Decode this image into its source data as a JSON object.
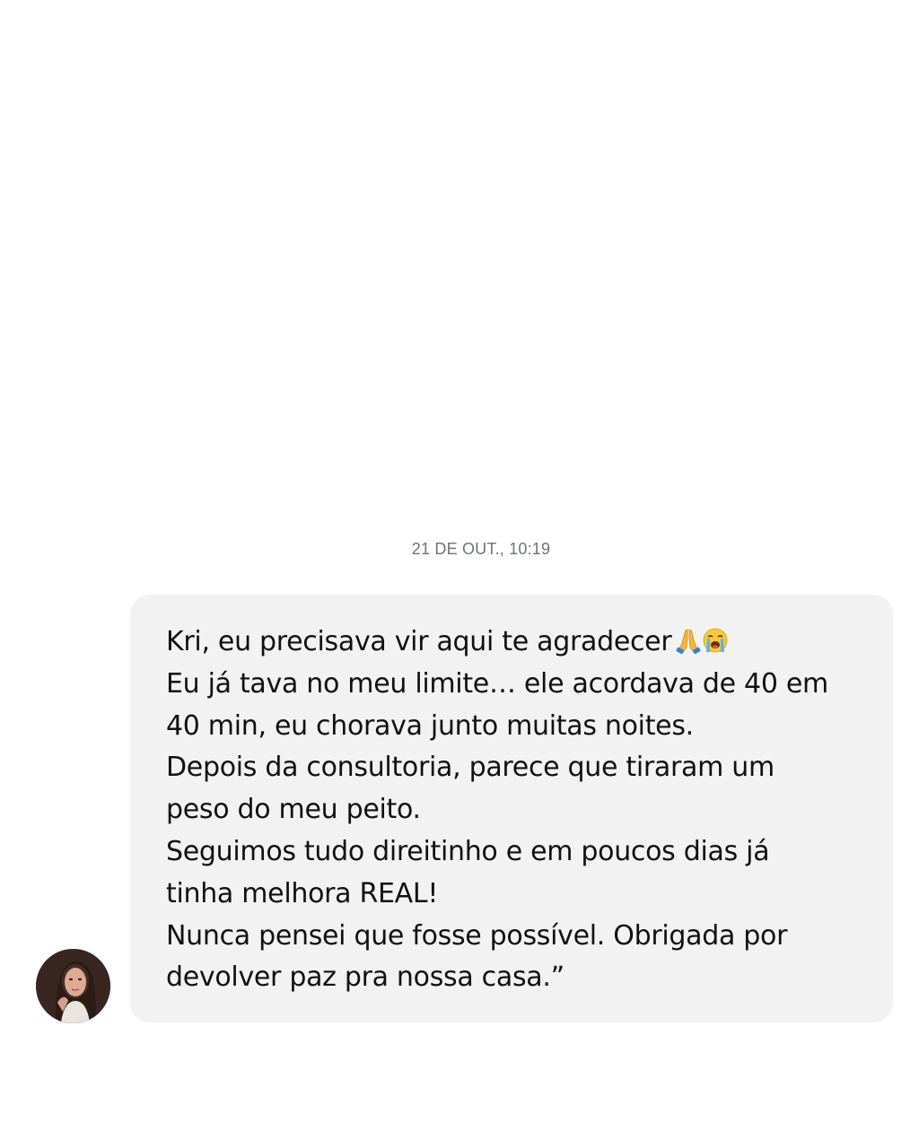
{
  "conversation": {
    "timestamp": "21 DE OUT., 10:19"
  },
  "message": {
    "lines": [
      "Kri, eu precisava vir aqui te agradecer",
      "Eu já tava no meu limite… ele acordava de 40 em",
      "40 min, eu chorava junto muitas noites.",
      "Depois da consultoria, parece que tiraram um",
      "peso do meu peito.",
      "Seguimos tudo direitinho e em poucos dias já",
      "tinha melhora REAL!",
      "Nunca pensei que fosse possível. Obrigada por",
      "devolver paz pra nossa casa.”"
    ],
    "emojis": [
      "folded-hands-emoji",
      "loudly-crying-face-emoji"
    ],
    "bubble_color": "#f2f2f2",
    "text_color": "#111111"
  },
  "sender": {
    "avatar": "profile-photo"
  }
}
